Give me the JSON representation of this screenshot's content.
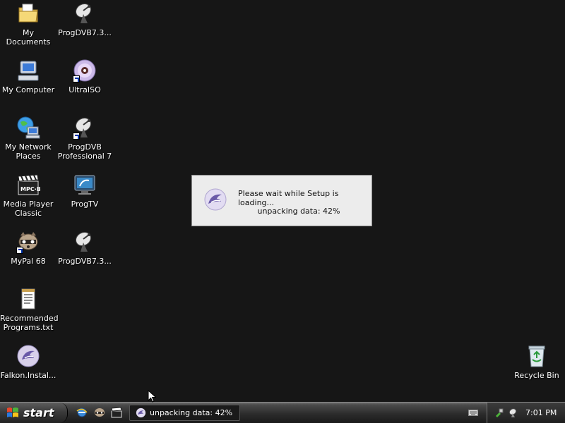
{
  "desktop": {
    "icons": [
      {
        "label": "My Documents",
        "icon": "folder-icon"
      },
      {
        "label": "ProgDVB7.3...",
        "icon": "satellite-dish-icon"
      },
      {
        "label": "My Computer",
        "icon": "computer-icon"
      },
      {
        "label": "UltraISO",
        "icon": "disc-icon"
      },
      {
        "label": "My Network Places",
        "icon": "network-globe-icon"
      },
      {
        "label": "ProgDVB Professional 7",
        "icon": "satellite-dish-icon"
      },
      {
        "label": "Media Player Classic",
        "icon": "clapperboard-icon"
      },
      {
        "label": "ProgTV",
        "icon": "tv-monitor-icon"
      },
      {
        "label": "MyPal 68",
        "icon": "raccoon-icon"
      },
      {
        "label": "ProgDVB7.3...",
        "icon": "satellite-dish-icon"
      },
      {
        "label": "Recommended Programs.txt",
        "icon": "text-file-icon"
      },
      {
        "label": "Falkon.Instal...",
        "icon": "falkon-installer-icon"
      },
      {
        "label": "Recycle Bin",
        "icon": "recycle-bin-icon"
      }
    ],
    "mpc_badge": "MPC·BE"
  },
  "dialog": {
    "line1": "Please wait while Setup is loading...",
    "line2": "unpacking data: 42%",
    "progress_percent": 42
  },
  "taskbar": {
    "start_label": "start",
    "task_button_label": "unpacking data: 42%",
    "clock": "7:01 PM"
  },
  "colors": {
    "desktop_bg": "#161616",
    "dialog_bg": "#ececec"
  }
}
